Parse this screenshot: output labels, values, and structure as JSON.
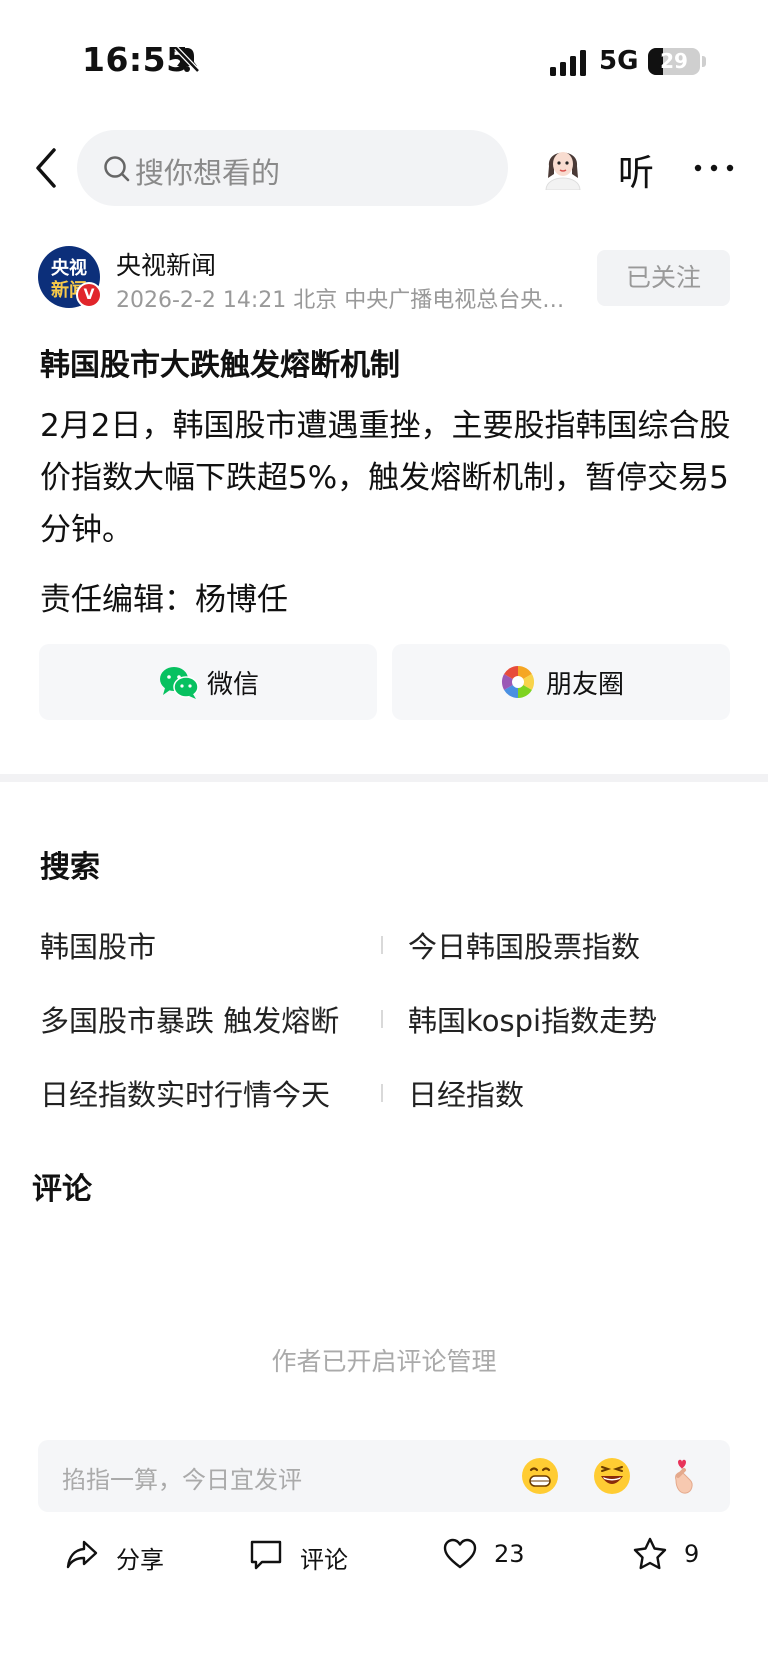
{
  "status_bar": {
    "time": "16:55",
    "network": "5G",
    "battery_level": "29",
    "battery_fraction": 0.29
  },
  "header": {
    "search_placeholder": "搜你想看的",
    "listen_label": "听"
  },
  "author": {
    "logo_line1": "央视",
    "logo_line2": "新闻",
    "verified_mark": "V",
    "name": "央视新闻",
    "meta": "2026-2-2  14:21  北京  中央广播电视总台央视新闻官方账号",
    "follow_label": "已关注"
  },
  "article": {
    "title": "韩国股市大跌触发熔断机制",
    "body": "2月2日，韩国股市遭遇重挫，主要股指韩国综合股价指数大幅下跌超5%，触发熔断机制，暂停交易5分钟。",
    "editor": "责任编辑：杨博任"
  },
  "share": {
    "wechat_label": "微信",
    "moments_label": "朋友圈"
  },
  "search_section": {
    "title": "搜索",
    "items": [
      "韩国股市",
      "今日韩国股票指数",
      "多国股市暴跌 触发熔断",
      "韩国kospi指数走势",
      "日经指数实时行情今天",
      "日经指数"
    ]
  },
  "comments": {
    "title": "评论",
    "notice": "作者已开启评论管理",
    "input_placeholder": "掐指一算，今日宜发评"
  },
  "actions": {
    "share_label": "分享",
    "comment_label": "评论",
    "like_count": "23",
    "favorite_count": "9"
  },
  "colors": {
    "wechat_green": "#07c160",
    "logo_blue": "#0c2f7a",
    "badge_red": "#e1252b",
    "muted_text": "#999999"
  }
}
